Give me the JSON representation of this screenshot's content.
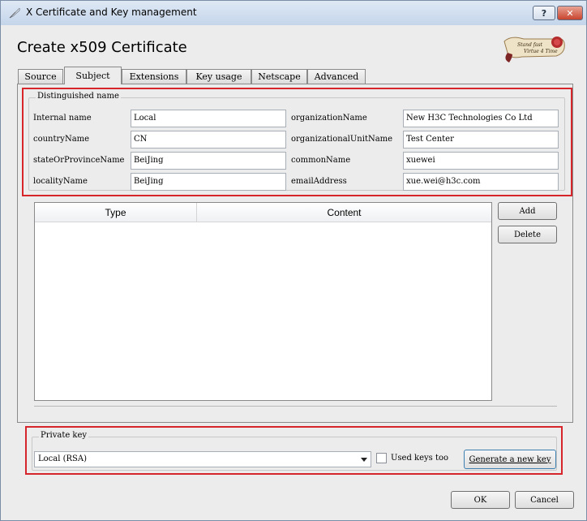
{
  "window": {
    "title": "X Certificate and Key management",
    "help_label": "?",
    "close_label": "✕"
  },
  "header": {
    "title": "Create x509 Certificate",
    "logo_text": "Stand fast Virtue 4 Time"
  },
  "tabs": [
    {
      "label": "Source",
      "active": false
    },
    {
      "label": "Subject",
      "active": true
    },
    {
      "label": "Extensions",
      "active": false
    },
    {
      "label": "Key usage",
      "active": false
    },
    {
      "label": "Netscape",
      "active": false
    },
    {
      "label": "Advanced",
      "active": false
    }
  ],
  "dn": {
    "group_title": "Distinguished name",
    "fields": [
      {
        "label": "Internal name",
        "value": "Local"
      },
      {
        "label": "countryName",
        "value": "CN"
      },
      {
        "label": "stateOrProvinceName",
        "value": "BeiJing"
      },
      {
        "label": "localityName",
        "value": "BeiJing"
      },
      {
        "label": "organizationName",
        "value": "New H3C Technologies Co Ltd"
      },
      {
        "label": "organizationalUnitName",
        "value": "Test Center"
      },
      {
        "label": "commonName",
        "value": "xuewei"
      },
      {
        "label": "emailAddress",
        "value": "xue.wei@h3c.com"
      }
    ]
  },
  "table": {
    "columns": [
      "Type",
      "Content"
    ],
    "add_label": "Add",
    "delete_label": "Delete"
  },
  "private_key": {
    "group_title": "Private key",
    "selected": "Local (RSA)",
    "used_keys_label": "Used keys too",
    "used_keys_checked": false,
    "generate_label": "Generate a new key"
  },
  "footer": {
    "ok_label": "OK",
    "cancel_label": "Cancel"
  },
  "colors": {
    "highlight_frame": "#d6262b",
    "titlebar": "#c4d5ea",
    "close_button": "#c8442e"
  }
}
